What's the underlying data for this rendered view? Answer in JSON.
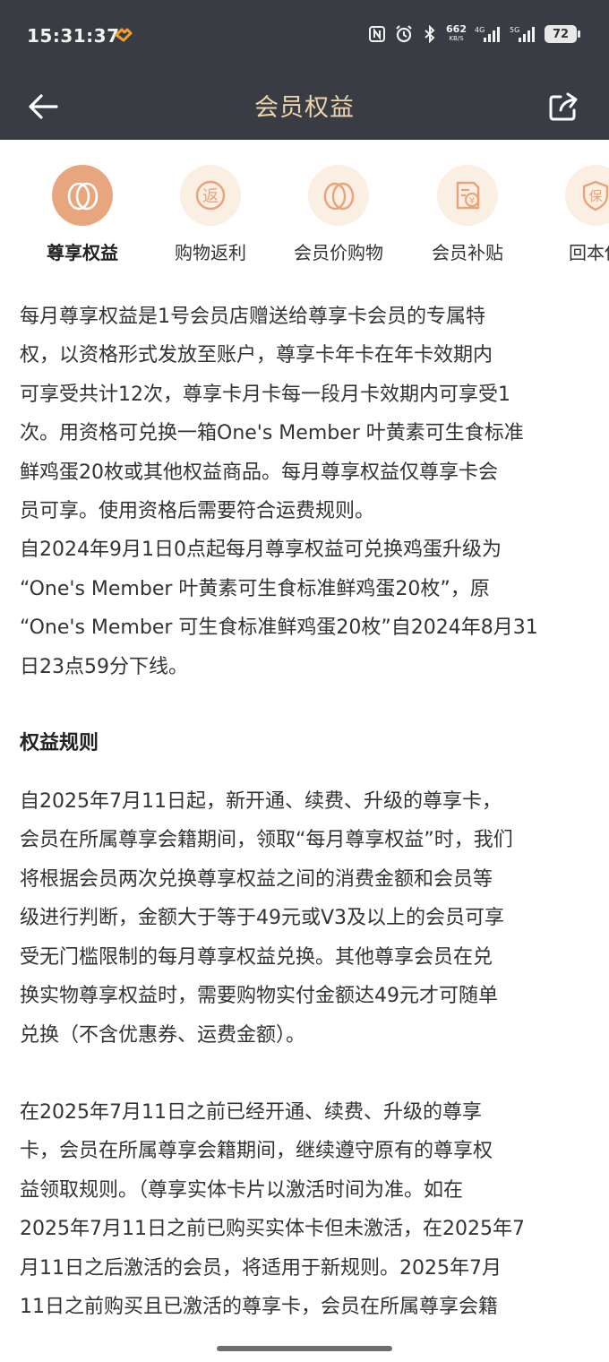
{
  "status_bar": {
    "time": "15:31:37",
    "net_speed": "662",
    "net_speed_unit": "KB/S",
    "sig1": "4G",
    "sig2": "5G",
    "battery": "72"
  },
  "header": {
    "title": "会员权益"
  },
  "tabs": [
    {
      "label": "尊享权益",
      "icon": "egg-icon",
      "active": true
    },
    {
      "label": "购物返利",
      "icon": "rebate-icon",
      "active": false
    },
    {
      "label": "会员价购物",
      "icon": "egg-icon",
      "active": false
    },
    {
      "label": "会员补贴",
      "icon": "subsidy-icon",
      "active": false
    },
    {
      "label": "回本保",
      "icon": "guarantee-icon",
      "active": false
    }
  ],
  "tab_icon_glyphs": {
    "rebate": "返",
    "subsidy": "¥",
    "guarantee": "保"
  },
  "content": {
    "intro_lines": [
      "每月尊享权益是1号会员店赠送给尊享卡会员的专属特",
      "权，以资格形式发放至账户，尊享卡年卡在年卡效期内",
      "可享受共计12次，尊享卡月卡每一段月卡效期内可享受1",
      "次。用资格可兑换一箱One's Member 叶黄素可生食标准",
      "鲜鸡蛋20枚或其他权益商品。每月尊享权益仅尊享卡会",
      "员可享。使用资格后需要符合运费规则。",
      "自2024年9月1日0点起每月尊享权益可兑换鸡蛋升级为",
      "“One's Member 叶黄素可生食标准鲜鸡蛋20枚”，原",
      "“One's Member 可生食标准鲜鸡蛋20枚”自2024年8月31",
      "日23点59分下线。"
    ],
    "rules_title": "权益规则",
    "rules_p1_lines": [
      "自2025年7月11日起，新开通、续费、升级的尊享卡，",
      "会员在所属尊享会籍期间，领取“每月尊享权益”时，我们",
      "将根据会员两次兑换尊享权益之间的消费金额和会员等",
      "级进行判断，金额大于等于49元或V3及以上的会员可享",
      "受无门槛限制的每月尊享权益兑换。其他尊享会员在兑",
      "换实物尊享权益时，需要购物实付金额达49元才可随单",
      "兑换（不含优惠券、运费金额）。"
    ],
    "rules_p2_lines": [
      "在2025年7月11日之前已经开通、续费、升级的尊享",
      "卡，会员在所属尊享会籍期间，继续遵守原有的尊享权",
      "益领取规则。（尊享实体卡片以激活时间为准。如在",
      "2025年7月11日之前已购买实体卡但未激活，在2025年7",
      "月11日之后激活的会员，将适用于新规则。2025年7月",
      "11日之前购买且已激活的尊享卡，会员在所属尊享会籍"
    ]
  },
  "colors": {
    "header_bg": "#3a3c44",
    "title_gold": "#ecd4ad",
    "active_circle": "#e7a67d",
    "inactive_circle": "#fbeee3",
    "icon_orange": "#e9a379"
  }
}
